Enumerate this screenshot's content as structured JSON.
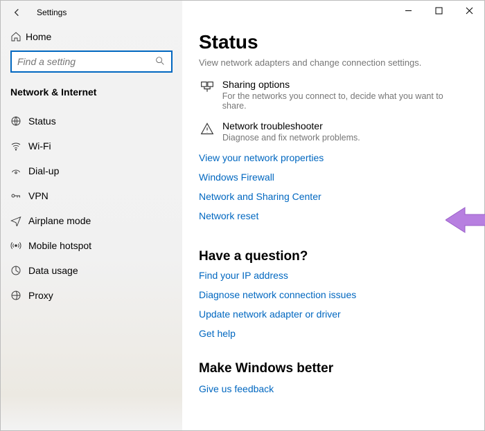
{
  "app": {
    "title": "Settings"
  },
  "search": {
    "placeholder": "Find a setting"
  },
  "home": {
    "label": "Home"
  },
  "category": {
    "header": "Network & Internet"
  },
  "nav": [
    {
      "name": "status",
      "label": "Status"
    },
    {
      "name": "wifi",
      "label": "Wi-Fi"
    },
    {
      "name": "dialup",
      "label": "Dial-up"
    },
    {
      "name": "vpn",
      "label": "VPN"
    },
    {
      "name": "airplane",
      "label": "Airplane mode"
    },
    {
      "name": "hotspot",
      "label": "Mobile hotspot"
    },
    {
      "name": "datausage",
      "label": "Data usage"
    },
    {
      "name": "proxy",
      "label": "Proxy"
    }
  ],
  "page": {
    "title": "Status",
    "faded_hint": "View network adapters and change connection settings.",
    "sharing": {
      "title": "Sharing options",
      "sub": "For the networks you connect to, decide what you want to share."
    },
    "trouble": {
      "title": "Network troubleshooter",
      "sub": "Diagnose and fix network problems."
    },
    "links": {
      "view_props": "View your network properties",
      "firewall": "Windows Firewall",
      "sharing_center": "Network and Sharing Center",
      "reset": "Network reset"
    },
    "question": {
      "header": "Have a question?",
      "find_ip": "Find your IP address",
      "diagnose": "Diagnose network connection issues",
      "update_adapter": "Update network adapter or driver",
      "get_help": "Get help"
    },
    "better": {
      "header": "Make Windows better",
      "feedback": "Give us feedback"
    }
  }
}
